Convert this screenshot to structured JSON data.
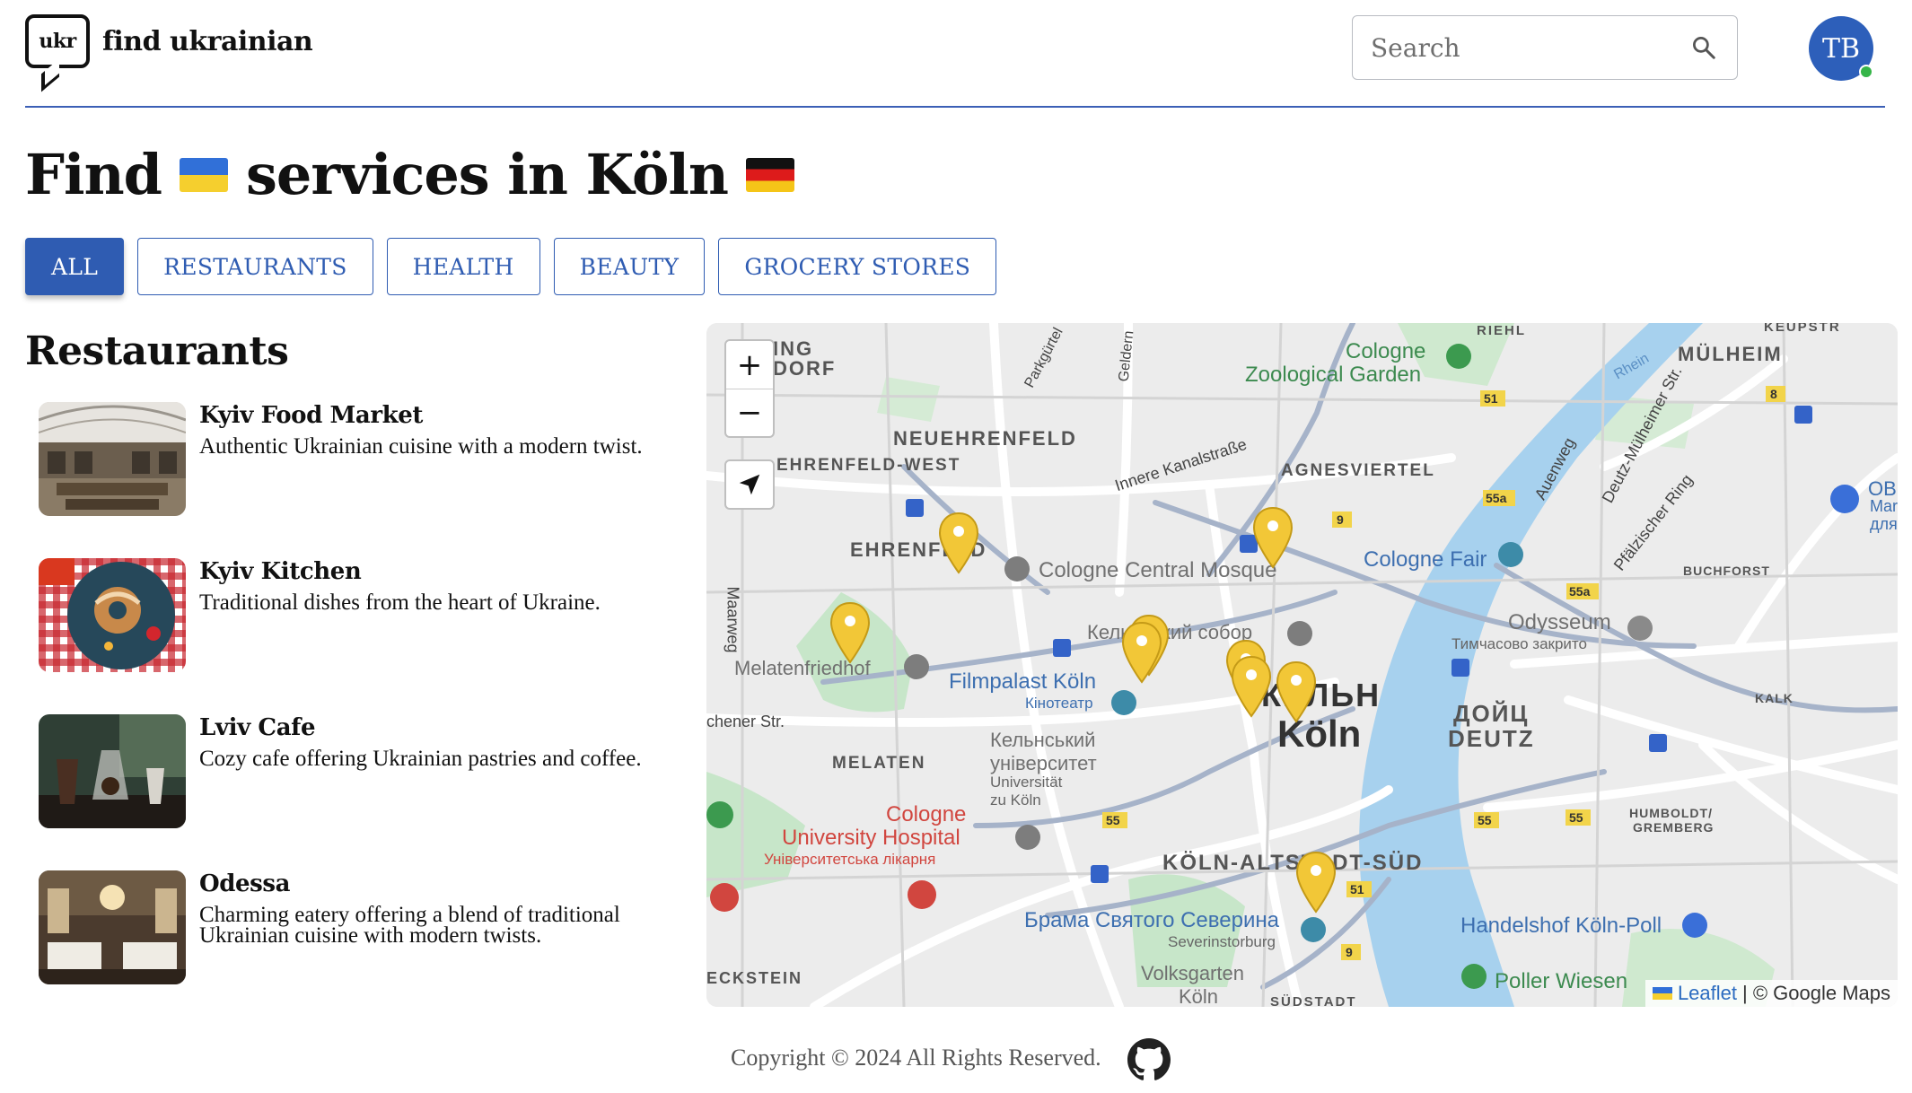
{
  "header": {
    "logo_badge": "ukr",
    "logo_text": "find ukrainian",
    "search_placeholder": "Search",
    "avatar_initials": "TB"
  },
  "title": {
    "prefix": "Find",
    "middle": "services in Köln"
  },
  "tabs": [
    {
      "label": "ALL",
      "active": true
    },
    {
      "label": "RESTAURANTS",
      "active": false
    },
    {
      "label": "HEALTH",
      "active": false
    },
    {
      "label": "BEAUTY",
      "active": false
    },
    {
      "label": "GROCERY STORES",
      "active": false
    }
  ],
  "section_title": "Restaurants",
  "restaurants": [
    {
      "name": "Kyiv Food Market",
      "description": "Authentic Ukrainian cuisine with a modern twist."
    },
    {
      "name": "Kyiv Kitchen",
      "description": "Traditional dishes from the heart of Ukraine."
    },
    {
      "name": "Lviv Cafe",
      "description": "Cozy cafe offering Ukrainian pastries and coffee."
    },
    {
      "name": "Odessa",
      "description": "Charming eatery offering a blend of traditional Ukrainian cuisine with modern twists."
    }
  ],
  "map": {
    "zoom_in": "+",
    "zoom_out": "−",
    "attribution_link": "Leaflet",
    "attribution_text": "| © Google Maps",
    "labels": {
      "neuehrenfeld": "NEUEHRENFELD",
      "ehrenfeld_west": "EHRENFELD-WEST",
      "ehrenfeld": "EHRENFELD",
      "agnesviertel": "AGNESVIERTEL",
      "muelheim": "MÜLHEIM",
      "riehl": "RIEHL",
      "zoo_1": "Cologne",
      "zoo_2": "Zoological Garden",
      "central_mosque": "Cologne Central Mosque",
      "cologne_fair": "Cologne Fair",
      "odysseum": "Odysseum",
      "odysseum_note": "Тимчасово закрито",
      "melatenfriedhof": "Melatenfriedhof",
      "filmpalast": "Filmpalast Köln",
      "filmpalast_ua": "Кінотеатр",
      "dom_ua": "Кельнський собор",
      "city_ua": "КЕЛЬН",
      "city": "Köln",
      "deutz_ua": "ДОЙЦ",
      "deutz": "DEUTZ",
      "melaten": "MELATEN",
      "uni_ua_1": "Кельнський",
      "uni_ua_2": "університет",
      "uni_1": "Universität",
      "uni_2": "zu Köln",
      "hospital_1": "Cologne",
      "hospital_2": "University Hospital",
      "hospital_ua": "Університетська лікарня",
      "altstadt_sued": "KÖLN-ALTSTADT-SÜD",
      "severin_ua": "Брама Святого Северина",
      "severin": "Severinstorburg",
      "volksgarten_1": "Volksgarten",
      "volksgarten_2": "Köln",
      "handelshof": "Handelshof Köln-Poll",
      "poller_wiesen": "Poller Wiesen",
      "humboldt": "HUMBOLDT/",
      "gremberg": "GREMBERG",
      "buchforst": "BUCHFORST",
      "kalk": "KALK",
      "eckstein": "ECKSTEIN",
      "suedstadt": "SÜDSTADT",
      "innere_kanal": "Innere Kanalstraße",
      "maarweg": "Maarweg",
      "venloer": "chener Str.",
      "pfalzischer": "Pfälzischer Ring",
      "deutz_muelheimer": "Deutz-Mülheimer Str.",
      "auenweg": "Auenweg",
      "parkguertel": "Parkgürtel",
      "geldern": "Geldern",
      "rhein": "Rhein",
      "keupstr": "KEUPSTR",
      "ob_1": "OB",
      "ob_2": "Mar",
      "ob_3": "для",
      "ing": "ING",
      "dorf": "DORF"
    }
  },
  "footer": {
    "copyright": "Copyright © 2024 All Rights Reserved."
  },
  "colors": {
    "accent": "#2f5cb2",
    "avatar": "#2d5fba",
    "online_dot": "#35b548",
    "marker": "#f2c737",
    "river": "#a7d1ee"
  },
  "icons": [
    "speech-bubble-logo-icon",
    "search-icon",
    "zoom-in-icon",
    "zoom-out-icon",
    "locate-arrow-icon",
    "map-marker-icon",
    "github-icon"
  ]
}
